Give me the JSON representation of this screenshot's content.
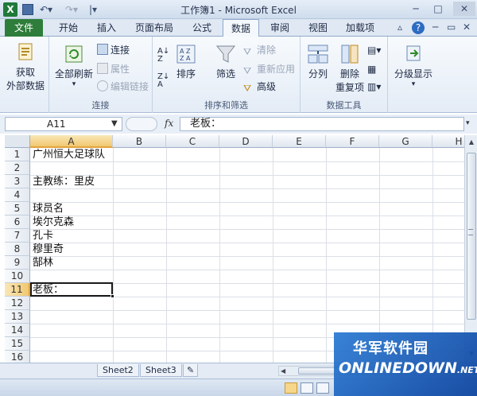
{
  "window": {
    "title": "工作簿1 - Microsoft Excel",
    "app_icon_letter": "X"
  },
  "tabs": [
    {
      "label": "文件",
      "active": false
    },
    {
      "label": "开始",
      "active": false
    },
    {
      "label": "插入",
      "active": false
    },
    {
      "label": "页面布局",
      "active": false
    },
    {
      "label": "公式",
      "active": false
    },
    {
      "label": "数据",
      "active": true
    },
    {
      "label": "审阅",
      "active": false
    },
    {
      "label": "视图",
      "active": false
    },
    {
      "label": "加载项",
      "active": false
    }
  ],
  "ribbon": {
    "get_external": {
      "line1": "获取",
      "line2": "外部数据"
    },
    "connections": {
      "refresh_all": "全部刷新",
      "connections": "连接",
      "properties": "属性",
      "edit_links": "编辑链接",
      "group_label": "连接"
    },
    "sort_filter": {
      "sort": "排序",
      "filter": "筛选",
      "clear": "清除",
      "reapply": "重新应用",
      "advanced": "高级",
      "group_label": "排序和筛选"
    },
    "data_tools": {
      "text_to_columns": "分列",
      "remove_dup_line1": "删除",
      "remove_dup_line2": "重复项",
      "group_label": "数据工具"
    },
    "outline": {
      "label": "分级显示"
    }
  },
  "formula_bar": {
    "name_box": "A11",
    "fx": "fx",
    "content": "老板："
  },
  "grid": {
    "columns": [
      "A",
      "B",
      "C",
      "D",
      "E",
      "F",
      "G",
      "H"
    ],
    "rows": [
      "1",
      "2",
      "3",
      "4",
      "5",
      "6",
      "7",
      "8",
      "9",
      "10",
      "11",
      "12",
      "13",
      "14",
      "15",
      "16"
    ],
    "active_column": "A",
    "active_row": "11",
    "cells": [
      {
        "row": 1,
        "text": "广州恒大足球队"
      },
      {
        "row": 3,
        "text": "主教练：里皮"
      },
      {
        "row": 5,
        "text": "球员名"
      },
      {
        "row": 6,
        "text": "埃尔克森"
      },
      {
        "row": 7,
        "text": "孔卡"
      },
      {
        "row": 8,
        "text": "穆里奇"
      },
      {
        "row": 9,
        "text": "郜林"
      },
      {
        "row": 11,
        "text": "老板："
      }
    ]
  },
  "sheets": [
    {
      "label": "Sheet2"
    },
    {
      "label": "Sheet3"
    }
  ],
  "watermark": {
    "chinese": "华军软件园",
    "english": "ONLINEDOWN",
    "suffix": ".NET"
  },
  "colors": {
    "file_tab": "#2e7d3a",
    "selection_header": "#f1c870",
    "watermark_blue": "#1f5fbf"
  }
}
